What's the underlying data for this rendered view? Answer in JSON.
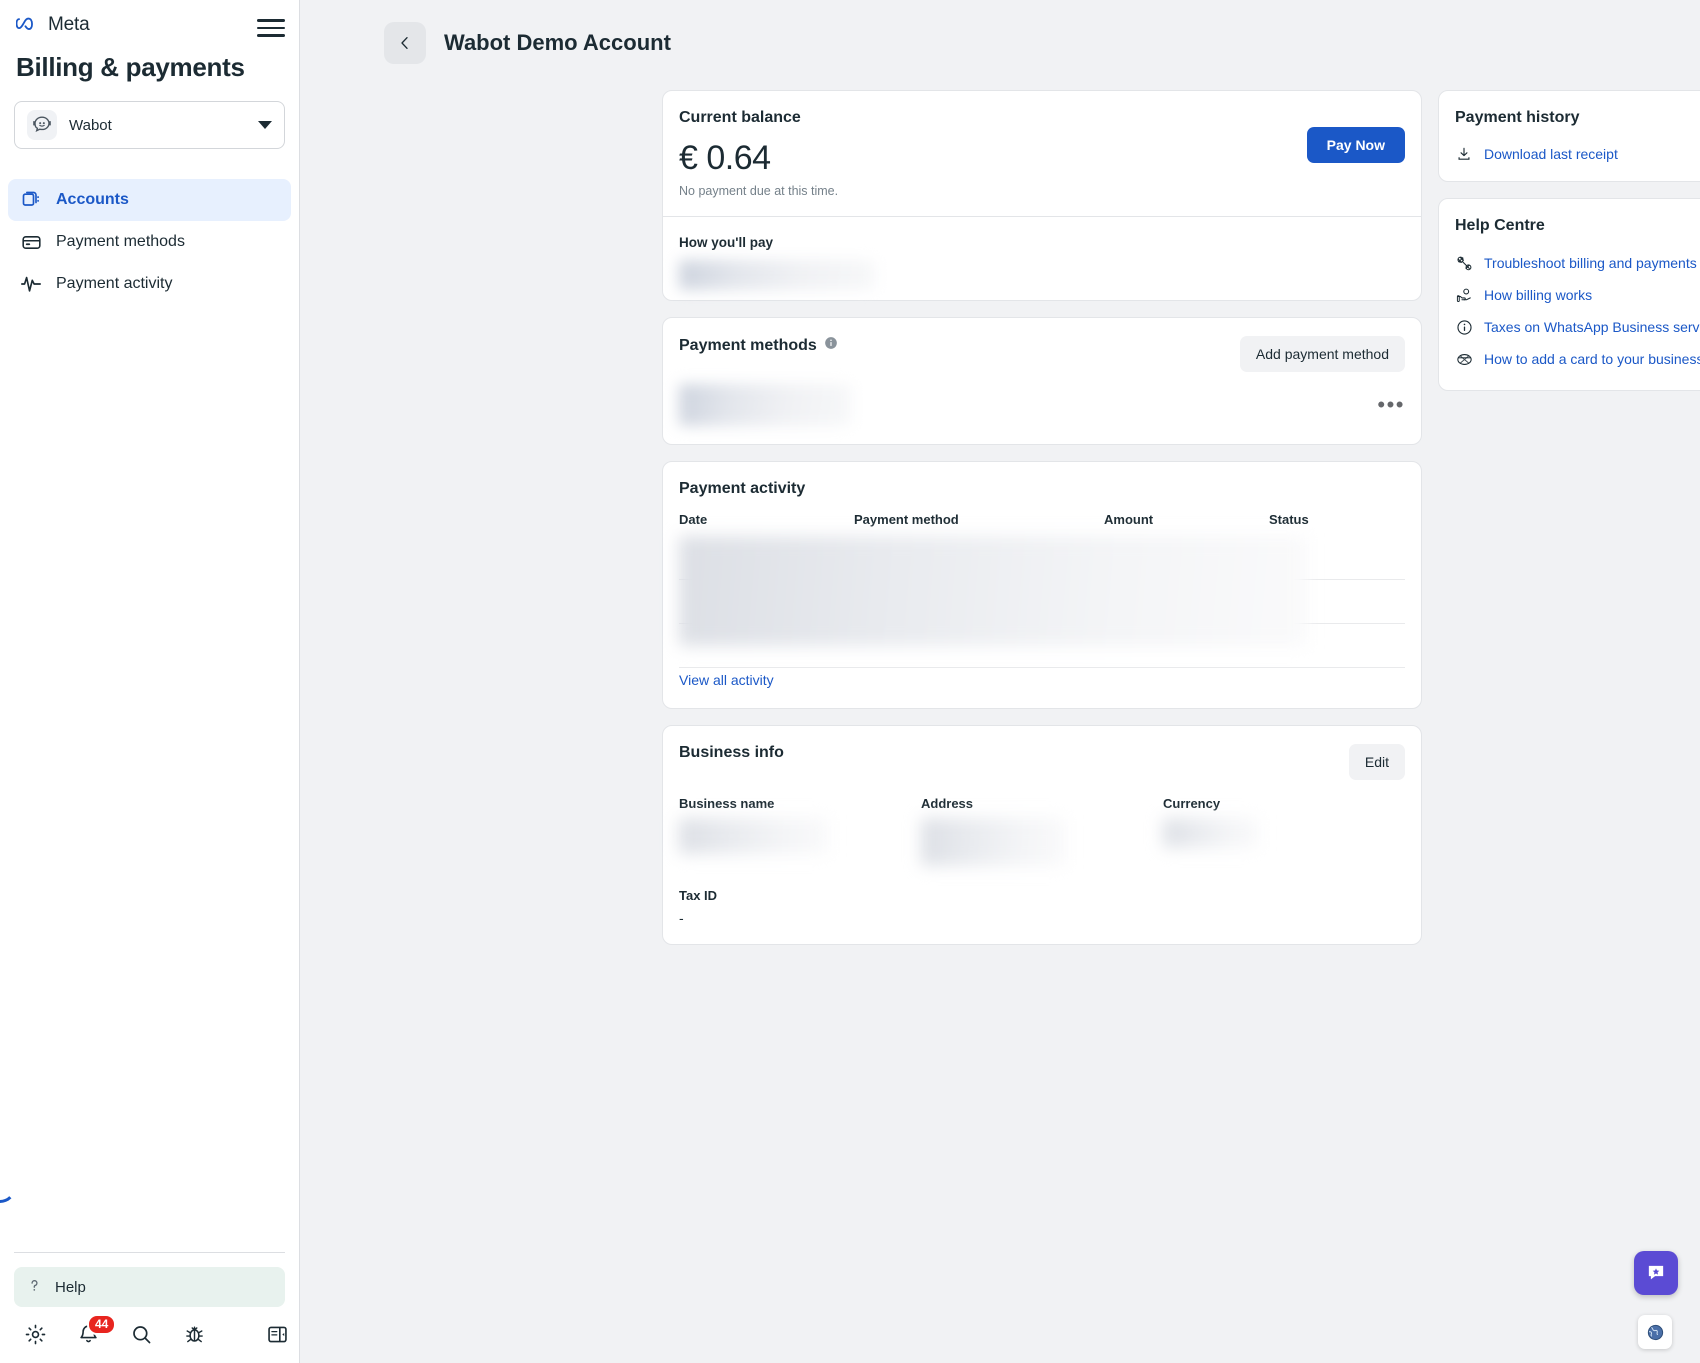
{
  "brand": {
    "name": "Meta",
    "accent": "#1b58c7",
    "badge_color": "#e8251f",
    "chat_fab_color": "#5b4bd4"
  },
  "sidebar": {
    "title": "Billing & payments",
    "account_selector": {
      "name": "Wabot",
      "avatar_icon": "chat-bot-avatar"
    },
    "items": [
      {
        "label": "Accounts",
        "icon": "accounts-icon",
        "active": true
      },
      {
        "label": "Payment methods",
        "icon": "credit-card-icon",
        "active": false
      },
      {
        "label": "Payment activity",
        "icon": "activity-pulse-icon",
        "active": false
      }
    ],
    "help": {
      "label": "Help",
      "icon": "question-mark-icon"
    },
    "tools": [
      {
        "name": "settings",
        "icon": "gear-icon",
        "badge": null
      },
      {
        "name": "notifications",
        "icon": "bell-icon",
        "badge": "44"
      },
      {
        "name": "search",
        "icon": "search-icon",
        "badge": null
      },
      {
        "name": "report-bug",
        "icon": "bug-icon",
        "badge": null
      },
      {
        "name": "collapse-panel",
        "icon": "panel-toggle-icon",
        "badge": null
      }
    ]
  },
  "header": {
    "title": "Wabot Demo Account",
    "back_icon": "chevron-left-icon"
  },
  "balance_card": {
    "heading": "Current balance",
    "amount": "€ 0.64",
    "note": "No payment due at this time.",
    "pay_button": "Pay Now",
    "how_youll_pay_heading": "How you'll pay"
  },
  "payment_methods_card": {
    "heading": "Payment methods",
    "info_icon": "info-icon",
    "add_button": "Add payment method",
    "more_icon": "ellipsis-icon"
  },
  "payment_activity_card": {
    "heading": "Payment activity",
    "columns": [
      "Date",
      "Payment method",
      "Amount",
      "Status"
    ],
    "rows": [
      [
        "",
        "",
        "",
        ""
      ],
      [
        "",
        "",
        "",
        ""
      ],
      [
        "",
        "",
        "",
        ""
      ]
    ],
    "view_all_link": "View all activity"
  },
  "business_info_card": {
    "heading": "Business info",
    "edit_button": "Edit",
    "fields": [
      {
        "label": "Business name",
        "value": ""
      },
      {
        "label": "Address",
        "value": ""
      },
      {
        "label": "Currency",
        "value": ""
      }
    ],
    "tax": {
      "label": "Tax ID",
      "value": "-"
    }
  },
  "payment_history_card": {
    "heading": "Payment history",
    "links": [
      {
        "label": "Download last receipt",
        "icon": "download-icon"
      }
    ]
  },
  "help_centre_card": {
    "heading": "Help Centre",
    "links": [
      {
        "label": "Troubleshoot billing and payments",
        "icon": "wrench-icon"
      },
      {
        "label": "How billing works",
        "icon": "hand-coin-icon"
      },
      {
        "label": "Taxes on WhatsApp Business services",
        "icon": "info-circle-icon"
      },
      {
        "label": "How to add a card to your business account",
        "icon": "card-add-icon"
      }
    ]
  },
  "floating": {
    "chat": {
      "icon": "chat-star-icon"
    },
    "globe": {
      "icon": "globe-icon"
    }
  }
}
